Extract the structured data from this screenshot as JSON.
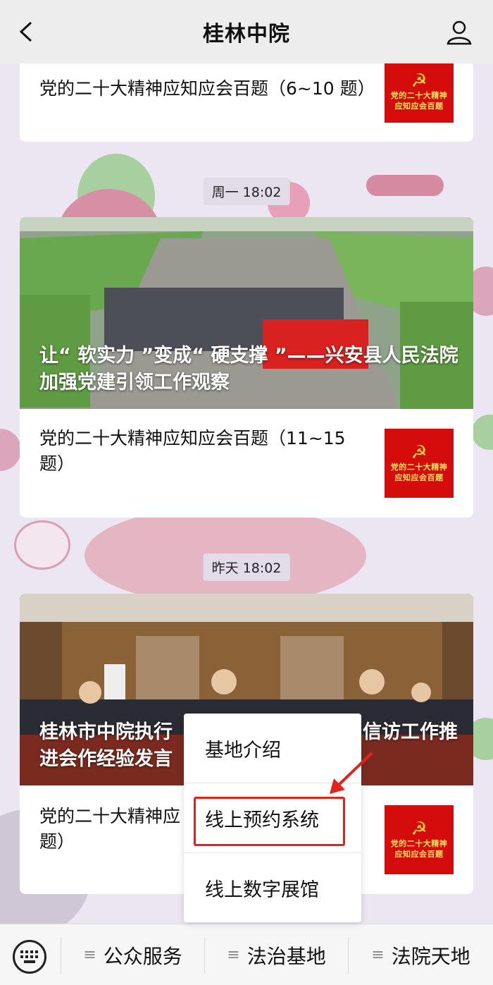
{
  "header": {
    "title": "桂林中院"
  },
  "cards": {
    "row1": {
      "text": "党的二十大精神应知应会百题（6~10 题）"
    },
    "stamp1": "周一 18:02",
    "hero1": {
      "caption": "让“ 软实力 ”变成“ 硬支撑 ”——兴安县人民法院加强党建引领工作观察"
    },
    "row2": {
      "text": "党的二十大精神应知应会百题（11~15 题）"
    },
    "stamp2": "昨天 18:02",
    "hero2": {
      "caption": "桂林市中院执行　　　　　　　　　　信访工作推进会作经验发言"
    },
    "row3": {
      "text": "党的二十大精神应　　　　　　　　　　　题）"
    }
  },
  "thumb": {
    "line1": "党的二十大精神",
    "line2": "应知应会百题",
    "icon": "party-emblem-icon"
  },
  "popup": {
    "items": [
      "基地介绍",
      "线上预约系统",
      "线上数字展馆"
    ]
  },
  "bottom": {
    "menus": [
      "公众服务",
      "法治基地",
      "法院天地"
    ],
    "keyboard_icon": "keyboard-icon"
  },
  "colors": {
    "accent_red": "#d40c0c",
    "highlight": "#e0241c",
    "bg": "#ece6f2"
  }
}
